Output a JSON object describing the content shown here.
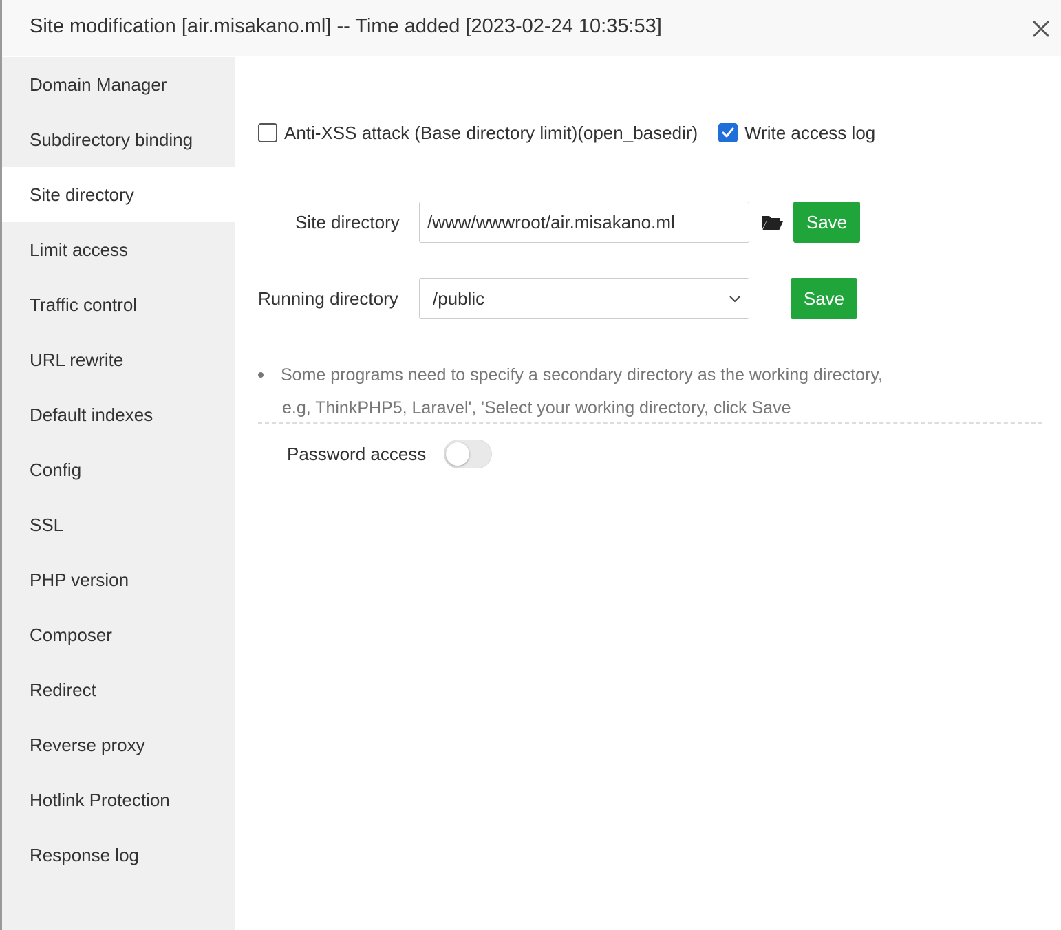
{
  "dialog": {
    "title": "Site modification [air.misakano.ml] -- Time added [2023-02-24 10:35:53]",
    "close_icon": "close-icon"
  },
  "sidebar": {
    "items": [
      {
        "label": "Domain Manager"
      },
      {
        "label": "Subdirectory binding"
      },
      {
        "label": "Site directory",
        "active": true
      },
      {
        "label": "Limit access"
      },
      {
        "label": "Traffic control"
      },
      {
        "label": "URL rewrite"
      },
      {
        "label": "Default indexes"
      },
      {
        "label": "Config"
      },
      {
        "label": "SSL"
      },
      {
        "label": "PHP version"
      },
      {
        "label": "Composer"
      },
      {
        "label": "Redirect"
      },
      {
        "label": "Reverse proxy"
      },
      {
        "label": "Hotlink Protection"
      },
      {
        "label": "Response log"
      }
    ]
  },
  "main": {
    "anti_xss": {
      "label": "Anti-XSS attack (Base directory limit)(open_basedir)",
      "checked": false
    },
    "access_log": {
      "label": "Write access log",
      "checked": true
    },
    "site_directory": {
      "label": "Site directory",
      "value": "/www/wwwroot/air.misakano.ml",
      "folder_icon": "folder-open-icon",
      "save_label": "Save"
    },
    "running_directory": {
      "label": "Running directory",
      "selected": "/public",
      "save_label": "Save"
    },
    "tip": {
      "line1": "Some programs need to specify a secondary directory as the working directory,",
      "line2": "e.g, ThinkPHP5, Laravel', 'Select your working directory, click Save"
    },
    "password_access": {
      "label": "Password access",
      "enabled": false
    }
  },
  "colors": {
    "accent_green": "#20a53a",
    "checkbox_blue": "#1e6fd9",
    "sidebar_bg": "#f0f0f0"
  }
}
